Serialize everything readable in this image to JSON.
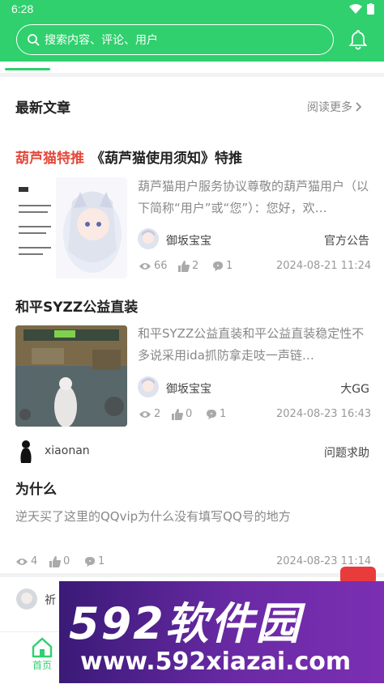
{
  "status_bar": {
    "time": "6:28"
  },
  "header": {
    "search_placeholder": "搜索内容、评论、用户",
    "bell_icon": "bell-icon"
  },
  "section": {
    "title": "最新文章",
    "read_more": "阅读更多"
  },
  "articles": [
    {
      "tag": "葫芦猫特推",
      "title": "《葫芦猫使用须知》特推",
      "excerpt": "葫芦猫用户服务协议尊敬的葫芦猫用户（以下简称“用户”或“您”）：您好，欢…",
      "author": "御坂宝宝",
      "category": "官方公告",
      "views": "66",
      "likes": "2",
      "comments": "1",
      "date": "2024-08-21 11:24"
    },
    {
      "tag": "",
      "title": "和平SYZZ公益直装",
      "excerpt": "和平SYZZ公益直装和平公益直装稳定性不多说采用ida抓防拿走吱一声链…",
      "author": "御坂宝宝",
      "category": "大GG",
      "views": "2",
      "likes": "0",
      "comments": "1",
      "date": "2024-08-23 16:43"
    }
  ],
  "post": {
    "author": "xiaonan",
    "category": "问题求助",
    "title": "为什么",
    "text": "逆天买了这里的QQvip为什么没有填写QQ号的地方",
    "views": "4",
    "likes": "0",
    "comments": "1",
    "date": "2024-08-23 11:14"
  },
  "next_post": {
    "author_partial": "祈"
  },
  "bottom_nav": {
    "home": "首页"
  },
  "watermark": {
    "brand": "592软件园",
    "url": "www.592xiazai.com"
  },
  "colors": {
    "accent": "#2fd06d",
    "tag_red": "#e4483a"
  }
}
